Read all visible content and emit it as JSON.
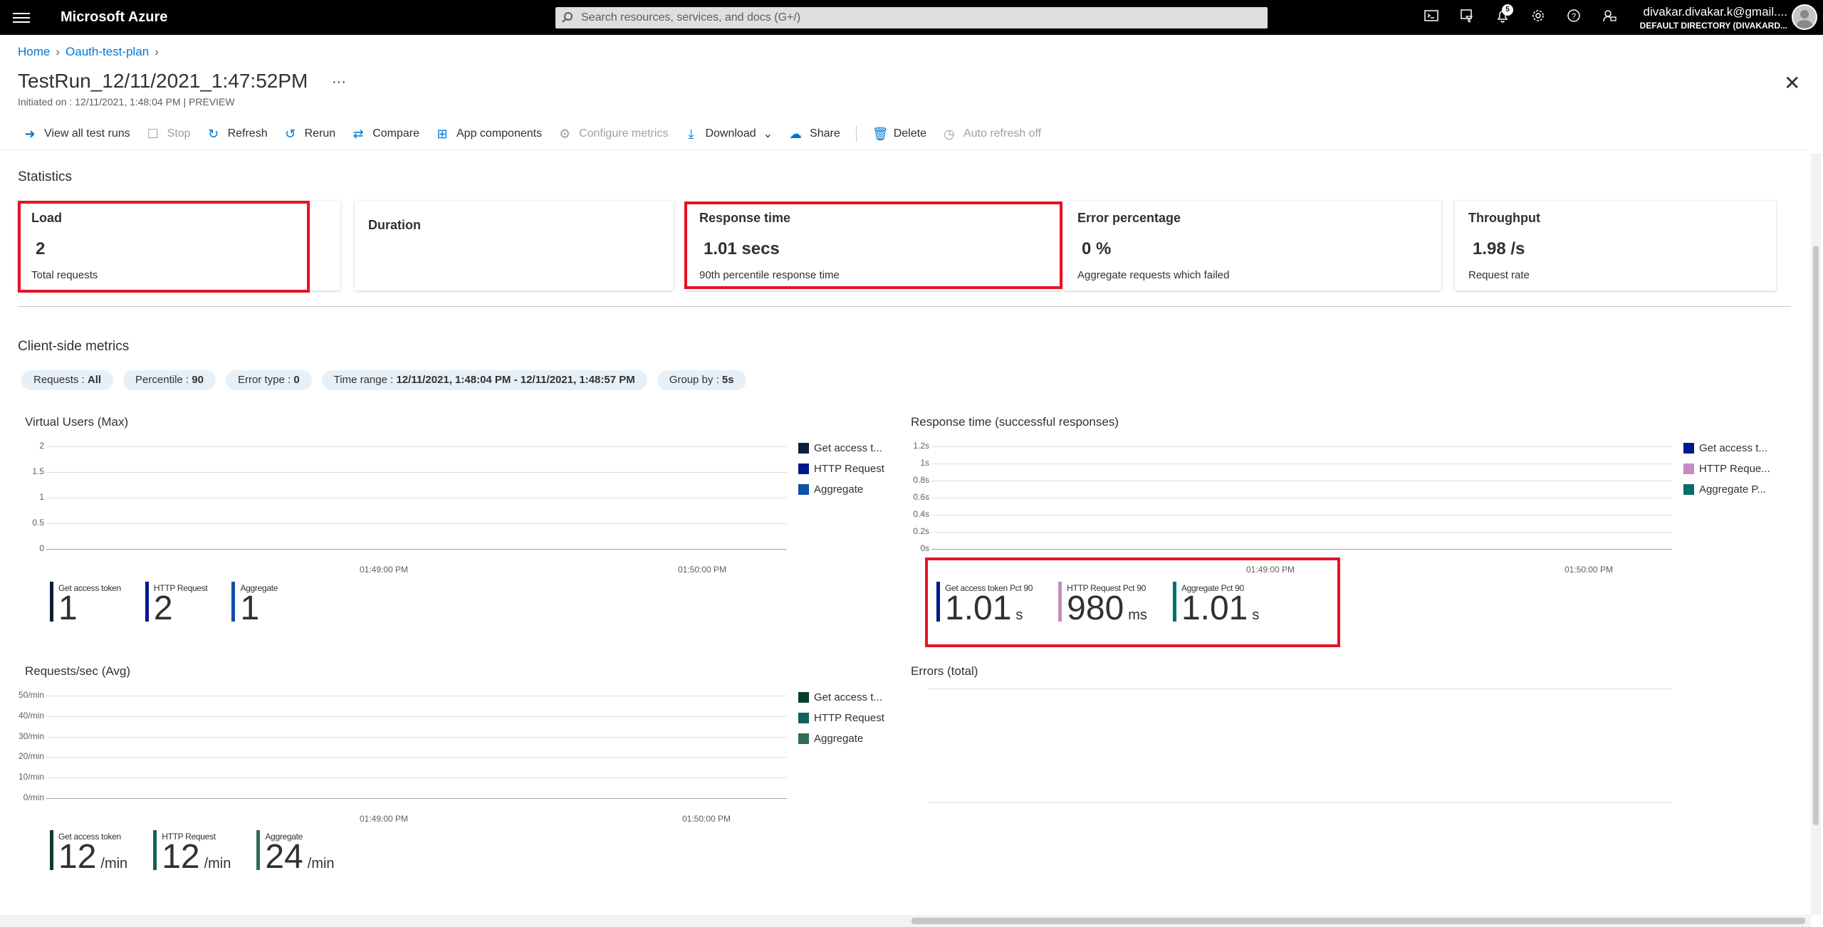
{
  "topbar": {
    "brand": "Microsoft Azure",
    "search_placeholder": "Search resources, services, and docs (G+/)",
    "notification_count": "5",
    "account_name": "divakar.divakar.k@gmail....",
    "account_directory": "DEFAULT DIRECTORY (DIVAKARD..."
  },
  "breadcrumb": {
    "home": "Home",
    "plan": "Oauth-test-plan"
  },
  "page": {
    "title": "TestRun_12/11/2021_1:47:52PM",
    "more": "···",
    "subtitle": "Initiated on : 12/11/2021, 1:48:04 PM | PREVIEW"
  },
  "toolbar": {
    "view_all": "View all test runs",
    "stop": "Stop",
    "refresh": "Refresh",
    "rerun": "Rerun",
    "compare": "Compare",
    "app_components": "App components",
    "configure_metrics": "Configure metrics",
    "download": "Download",
    "share": "Share",
    "delete": "Delete",
    "auto_refresh": "Auto refresh off"
  },
  "statistics": {
    "heading": "Statistics",
    "cards": [
      {
        "label": "Load",
        "value": "2",
        "desc": "Total requests"
      },
      {
        "label": "Duration",
        "value": "",
        "desc": ""
      },
      {
        "label": "Response time",
        "value": "1.01 secs",
        "desc": "90th percentile response time"
      },
      {
        "label": "Error percentage",
        "value": "0 %",
        "desc": "Aggregate requests which failed"
      },
      {
        "label": "Throughput",
        "value": "1.98 /s",
        "desc": "Request rate"
      }
    ]
  },
  "client_metrics": {
    "heading": "Client-side metrics",
    "filters": [
      {
        "key": "Requests : ",
        "value": "All"
      },
      {
        "key": "Percentile : ",
        "value": "90"
      },
      {
        "key": "Error type : ",
        "value": "0"
      },
      {
        "key": "Time range : ",
        "value": "12/11/2021, 1:48:04 PM - 12/11/2021, 1:48:57 PM"
      },
      {
        "key": "Group by : ",
        "value": "5s"
      }
    ]
  },
  "colors": {
    "navy_dark": "#0b1f3a",
    "navy": "#00188f",
    "blue": "#0f4fa8",
    "pink": "#c28dbf",
    "teal": "#006e6a",
    "green_dark": "#0b3d2e",
    "teal2": "#106060",
    "green": "#2f6e55",
    "highlight": "#e81123"
  },
  "chart_data": [
    {
      "type": "line",
      "title": "Virtual Users (Max)",
      "yticks": [
        "2",
        "1.5",
        "1",
        "0.5",
        "0"
      ],
      "xticks": [
        "01:49:00 PM",
        "01:50:00 PM"
      ],
      "ylim": [
        0,
        2
      ],
      "series": [
        {
          "name": "Get access t...",
          "kpi_name": "Get access token",
          "kpi_value": "1",
          "kpi_unit": ""
        },
        {
          "name": "HTTP Request",
          "kpi_name": "HTTP Request",
          "kpi_value": "2",
          "kpi_unit": ""
        },
        {
          "name": "Aggregate",
          "kpi_name": "Aggregate",
          "kpi_value": "1",
          "kpi_unit": ""
        }
      ]
    },
    {
      "type": "line",
      "title": "Response time (successful responses)",
      "yticks": [
        "1.2s",
        "1s",
        "0.8s",
        "0.6s",
        "0.4s",
        "0.2s",
        "0s"
      ],
      "xticks": [
        "01:49:00 PM",
        "01:50:00 PM"
      ],
      "ylim": [
        0,
        1.2
      ],
      "series": [
        {
          "name": "Get access t...",
          "kpi_name": "Get access token Pct 90",
          "kpi_value": "1.01",
          "kpi_unit": "s"
        },
        {
          "name": "HTTP Reque...",
          "kpi_name": "HTTP Request Pct 90",
          "kpi_value": "980",
          "kpi_unit": "ms"
        },
        {
          "name": "Aggregate P...",
          "kpi_name": "Aggregate Pct 90",
          "kpi_value": "1.01",
          "kpi_unit": "s"
        }
      ]
    },
    {
      "type": "line",
      "title": "Requests/sec (Avg)",
      "yticks": [
        "50/min",
        "40/min",
        "30/min",
        "20/min",
        "10/min",
        "0/min"
      ],
      "xticks": [
        "01:49:00 PM",
        "01:50:00 PM"
      ],
      "ylim": [
        0,
        50
      ],
      "series": [
        {
          "name": "Get access t...",
          "kpi_name": "Get access token",
          "kpi_value": "12",
          "kpi_unit": "/min"
        },
        {
          "name": "HTTP Request",
          "kpi_name": "HTTP Request",
          "kpi_value": "12",
          "kpi_unit": "/min"
        },
        {
          "name": "Aggregate",
          "kpi_name": "Aggregate",
          "kpi_value": "24",
          "kpi_unit": "/min"
        }
      ]
    },
    {
      "type": "line",
      "title": "Errors (total)",
      "series": []
    }
  ]
}
